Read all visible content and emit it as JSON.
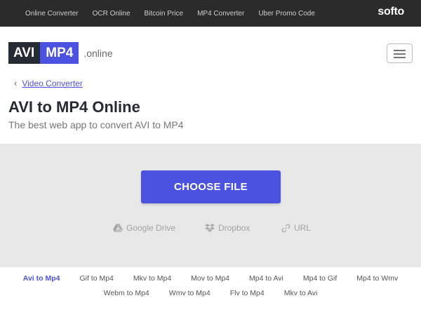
{
  "topnav": {
    "items": [
      "Online Converter",
      "OCR Online",
      "Bitcoin Price",
      "MP4 Converter",
      "Uber Promo Code"
    ],
    "brand": "softo"
  },
  "logo": {
    "part1": "AVI",
    "part2": "MP4",
    "suffix": ".online"
  },
  "breadcrumb": {
    "label": "Video Converter"
  },
  "page": {
    "title": "AVI to MP4 Online",
    "subtitle": "The best web app to convert AVI to MP4"
  },
  "upload": {
    "button": "CHOOSE FILE",
    "sources": [
      "Google Drive",
      "Dropbox",
      "URL"
    ]
  },
  "conversions": {
    "row1": [
      "Avi to Mp4",
      "Gif to Mp4",
      "Mkv to Mp4",
      "Mov to Mp4",
      "Mp4 to Avi",
      "Mp4 to Gif",
      "Mp4 to Wmv"
    ],
    "row2": [
      "Webm to Mp4",
      "Wmv to Mp4",
      "Flv to Mp4",
      "Mkv to Avi"
    ],
    "active": "Avi to Mp4"
  },
  "colors": {
    "accent": "#4c52e0",
    "topbar": "#2b2b2b",
    "dark": "#262a33",
    "dropzone": "#e8e8e8"
  }
}
